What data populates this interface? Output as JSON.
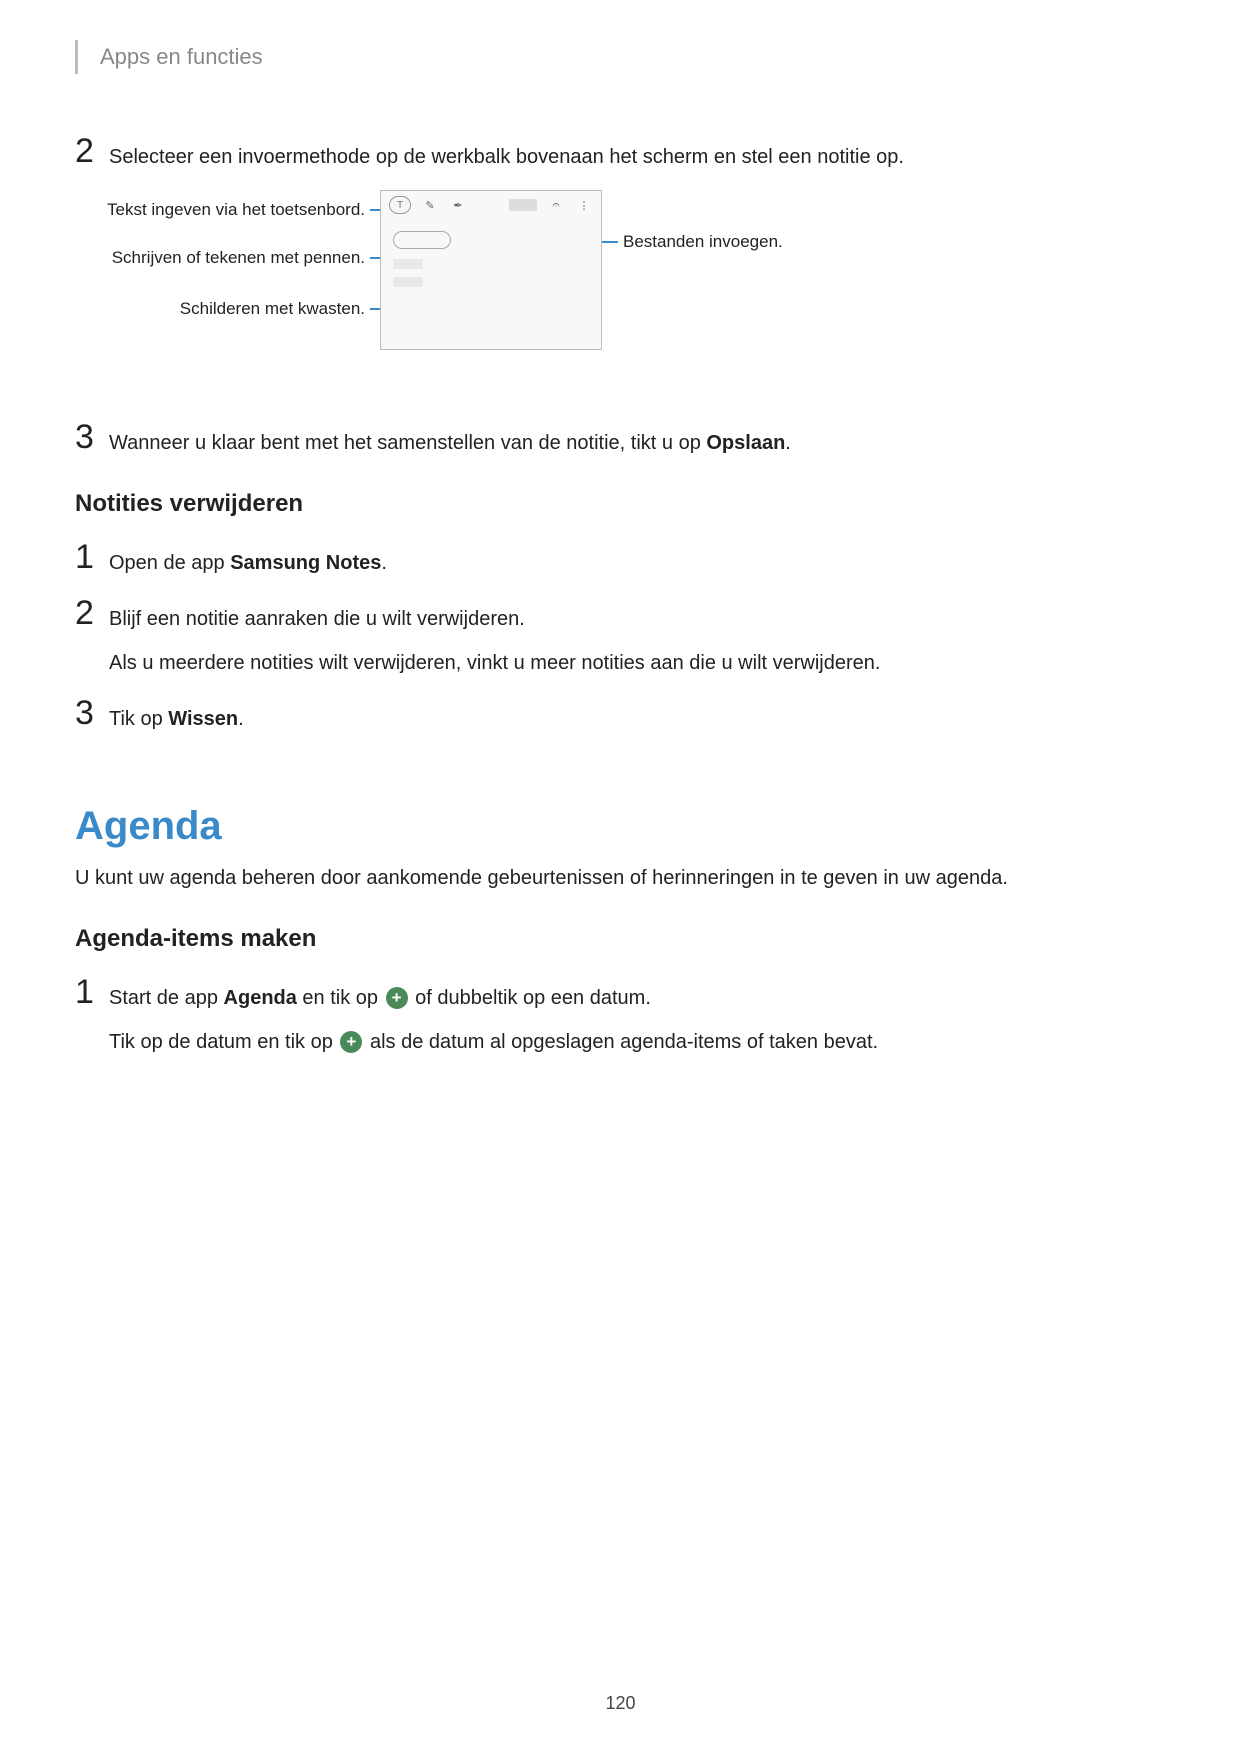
{
  "header": "Apps en functies",
  "topSteps": {
    "step2": {
      "num": "2",
      "text": "Selecteer een invoermethode op de werkbalk bovenaan het scherm en stel een notitie op."
    },
    "step3": {
      "num": "3",
      "text_before": "Wanneer u klaar bent met het samenstellen van de notitie, tikt u op ",
      "bold": "Opslaan",
      "text_after": "."
    }
  },
  "diagram": {
    "label1": "Tekst ingeven via het toetsenbord.",
    "label2": "Schrijven of tekenen met pennen.",
    "label3": "Schilderen met kwasten.",
    "label4": "Bestanden invoegen.",
    "iconT": "T",
    "iconPen": "✎",
    "iconBrush": "✒",
    "iconAttach": "𝄐",
    "iconMore": "⋮"
  },
  "deleteSection": {
    "heading": "Notities verwijderen",
    "step1": {
      "num": "1",
      "before": "Open de app ",
      "bold": "Samsung Notes",
      "after": "."
    },
    "step2": {
      "num": "2",
      "line1": "Blijf een notitie aanraken die u wilt verwijderen.",
      "line2": "Als u meerdere notities wilt verwijderen, vinkt u meer notities aan die u wilt verwijderen."
    },
    "step3": {
      "num": "3",
      "before": "Tik op ",
      "bold": "Wissen",
      "after": "."
    }
  },
  "agendaSection": {
    "title": "Agenda",
    "intro": "U kunt uw agenda beheren door aankomende gebeurtenissen of herinneringen in te geven in uw agenda.",
    "subheading": "Agenda-items maken",
    "step1": {
      "num": "1",
      "p1_before": "Start de app ",
      "p1_bold": "Agenda",
      "p1_mid": " en tik op ",
      "p1_after": " of dubbeltik op een datum.",
      "p2_before": "Tik op de datum en tik op ",
      "p2_after": " als de datum al opgeslagen agenda-items of taken bevat."
    }
  },
  "pageNumber": "120"
}
